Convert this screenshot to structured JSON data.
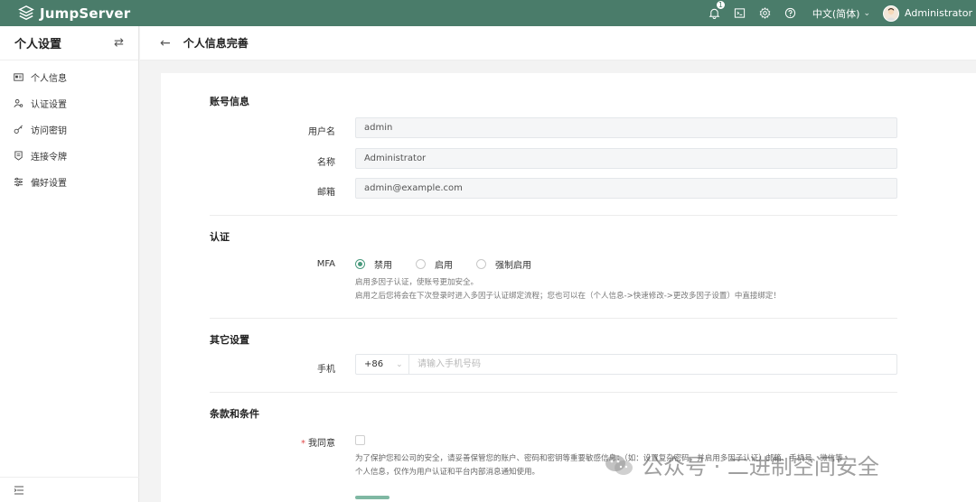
{
  "app": {
    "brand": "JumpServer"
  },
  "topbar": {
    "notification_count": "1",
    "language": "中文(简体)",
    "username": "Administrator"
  },
  "sidebar": {
    "title": "个人设置",
    "items": [
      {
        "label": "个人信息",
        "icon": "id-card-icon"
      },
      {
        "label": "认证设置",
        "icon": "user-gear-icon"
      },
      {
        "label": "访问密钥",
        "icon": "key-icon"
      },
      {
        "label": "连接令牌",
        "icon": "token-icon"
      },
      {
        "label": "偏好设置",
        "icon": "sliders-icon"
      }
    ]
  },
  "page": {
    "title": "个人信息完善"
  },
  "account": {
    "section_title": "账号信息",
    "username_label": "用户名",
    "username_value": "admin",
    "name_label": "名称",
    "name_value": "Administrator",
    "email_label": "邮箱",
    "email_value": "admin@example.com"
  },
  "auth": {
    "section_title": "认证",
    "mfa_label": "MFA",
    "options": [
      "禁用",
      "启用",
      "强制启用"
    ],
    "selected": "禁用",
    "help_line1": "启用多因子认证，使账号更加安全。",
    "help_line2": "启用之后您将会在下次登录时进入多因子认证绑定流程；您也可以在（个人信息->快速修改->更改多因子设置）中直接绑定！"
  },
  "other": {
    "section_title": "其它设置",
    "phone_label": "手机",
    "country_code": "+86",
    "phone_placeholder": "请输入手机号码"
  },
  "terms": {
    "section_title": "条款和条件",
    "agree_label": "我同意",
    "required_mark": "*",
    "text": "为了保护您和公司的安全，请妥善保管您的账户、密码和密钥等重要敏感信息；（如：设置复杂密码，并启用多因子认证）邮箱、手机号、微信等个人信息，仅作为用户认证和平台内部消息通知使用。"
  },
  "watermark": {
    "text": "公众号 · 二进制空间安全"
  },
  "colors": {
    "brand": "#4a7c6a",
    "accent": "#4a9a7e"
  }
}
